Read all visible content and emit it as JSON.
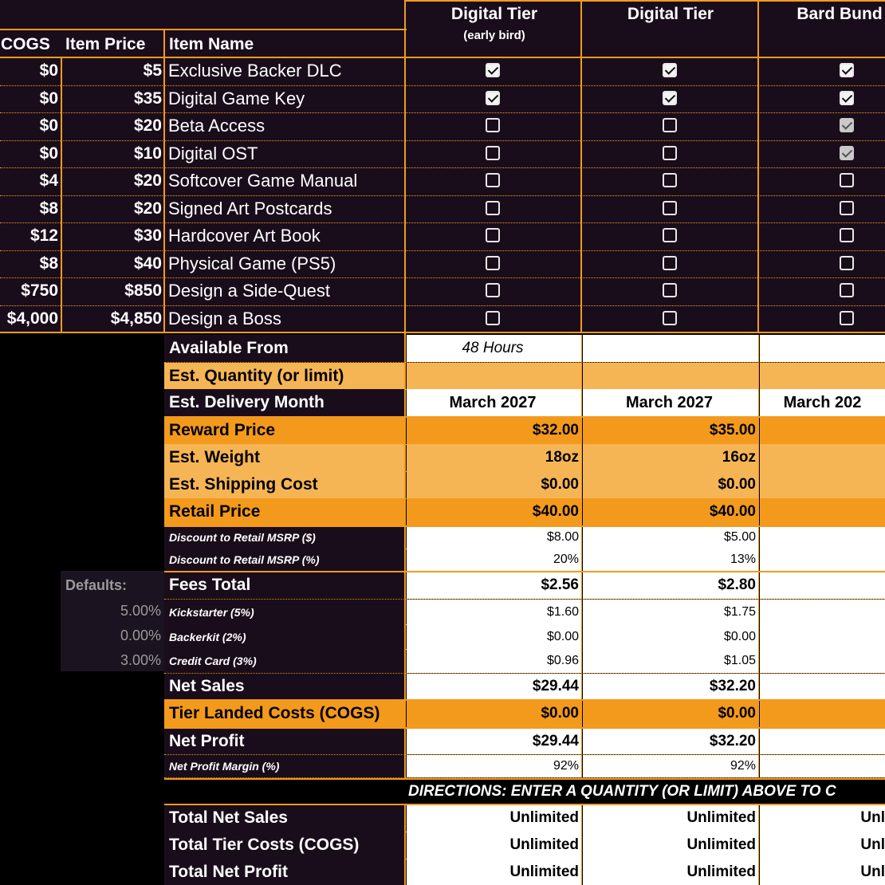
{
  "columns": {
    "cogs": "COGS",
    "item_price": "Item Price",
    "item_name": "Item Name"
  },
  "tiers": [
    {
      "name": "Digital Tier",
      "sub": "(early bird)"
    },
    {
      "name": "Digital Tier",
      "sub": ""
    },
    {
      "name": "Bard Bund",
      "sub": ""
    }
  ],
  "items": [
    {
      "cogs": "$0",
      "price": "$5",
      "name": "Exclusive Backer DLC",
      "checks": [
        "on",
        "on",
        "on"
      ]
    },
    {
      "cogs": "$0",
      "price": "$35",
      "name": "Digital Game Key",
      "checks": [
        "on",
        "on",
        "on"
      ]
    },
    {
      "cogs": "$0",
      "price": "$20",
      "name": "Beta Access",
      "checks": [
        "off",
        "off",
        "grey"
      ]
    },
    {
      "cogs": "$0",
      "price": "$10",
      "name": "Digital OST",
      "checks": [
        "off",
        "off",
        "grey"
      ]
    },
    {
      "cogs": "$4",
      "price": "$20",
      "name": "Softcover Game Manual",
      "checks": [
        "off",
        "off",
        "off"
      ]
    },
    {
      "cogs": "$8",
      "price": "$20",
      "name": "Signed Art Postcards",
      "checks": [
        "off",
        "off",
        "off"
      ]
    },
    {
      "cogs": "$12",
      "price": "$30",
      "name": "Hardcover Art Book",
      "checks": [
        "off",
        "off",
        "off"
      ]
    },
    {
      "cogs": "$8",
      "price": "$40",
      "name": "Physical Game (PS5)",
      "checks": [
        "off",
        "off",
        "off"
      ]
    },
    {
      "cogs": "$750",
      "price": "$850",
      "name": "Design a Side-Quest",
      "checks": [
        "off",
        "off",
        "off"
      ]
    },
    {
      "cogs": "$4,000",
      "price": "$4,850",
      "name": "Design a Boss",
      "checks": [
        "off",
        "off",
        "off"
      ]
    }
  ],
  "rows": {
    "available_from": {
      "label": "Available From",
      "values": [
        "48 Hours",
        "",
        ""
      ]
    },
    "est_quantity": {
      "label": "Est. Quantity (or limit)",
      "values": [
        "",
        "",
        ""
      ]
    },
    "est_delivery": {
      "label": "Est. Delivery Month",
      "values": [
        "March 2027",
        "March 2027",
        "March 202"
      ]
    },
    "reward_price": {
      "label": "Reward Price",
      "values": [
        "$32.00",
        "$35.00",
        ""
      ]
    },
    "est_weight": {
      "label": "Est. Weight",
      "values": [
        "18oz",
        "16oz",
        ""
      ]
    },
    "est_shipping": {
      "label": "Est. Shipping Cost",
      "values": [
        "$0.00",
        "$0.00",
        ""
      ]
    },
    "retail_price": {
      "label": "Retail Price",
      "values": [
        "$40.00",
        "$40.00",
        ""
      ]
    },
    "discount_usd": {
      "label": "Discount to Retail MSRP ($)",
      "values": [
        "$8.00",
        "$5.00",
        ""
      ]
    },
    "discount_pct": {
      "label": "Discount to Retail MSRP (%)",
      "values": [
        "20%",
        "13%",
        ""
      ]
    },
    "fees_total": {
      "label": "Fees Total",
      "values": [
        "$2.56",
        "$2.80",
        ""
      ]
    },
    "kickstarter": {
      "label": "Kickstarter (5%)",
      "values": [
        "$1.60",
        "$1.75",
        ""
      ]
    },
    "backerkit": {
      "label": "Backerkit (2%)",
      "values": [
        "$0.00",
        "$0.00",
        ""
      ]
    },
    "credit_card": {
      "label": "Credit Card (3%)",
      "values": [
        "$0.96",
        "$1.05",
        ""
      ]
    },
    "net_sales": {
      "label": "Net Sales",
      "values": [
        "$29.44",
        "$32.20",
        ""
      ]
    },
    "tier_landed": {
      "label": "Tier Landed Costs (COGS)",
      "values": [
        "$0.00",
        "$0.00",
        ""
      ]
    },
    "net_profit": {
      "label": "Net Profit",
      "values": [
        "$29.44",
        "$32.20",
        ""
      ]
    },
    "net_margin": {
      "label": "Net Profit Margin (%)",
      "values": [
        "92%",
        "92%",
        ""
      ]
    },
    "total_net_sales": {
      "label": "Total Net Sales",
      "values": [
        "Unlimited",
        "Unlimited",
        "Unl"
      ]
    },
    "total_tier_costs": {
      "label": "Total Tier Costs (COGS)",
      "values": [
        "Unlimited",
        "Unlimited",
        "Unl"
      ]
    },
    "total_net_profit": {
      "label": "Total Net Profit",
      "values": [
        "Unlimited",
        "Unlimited",
        "Unl"
      ]
    }
  },
  "defaults": {
    "label": "Defaults:",
    "kickstarter": "5.00%",
    "backerkit": "0.00%",
    "credit_card": "3.00%"
  },
  "directions": "DIRECTIONS:  ENTER A QUANTITY (OR LIMIT) ABOVE TO C",
  "colors": {
    "accent": "#f39a1d",
    "accent_light": "#f6b555",
    "dark_bg": "#1a0d1b"
  }
}
